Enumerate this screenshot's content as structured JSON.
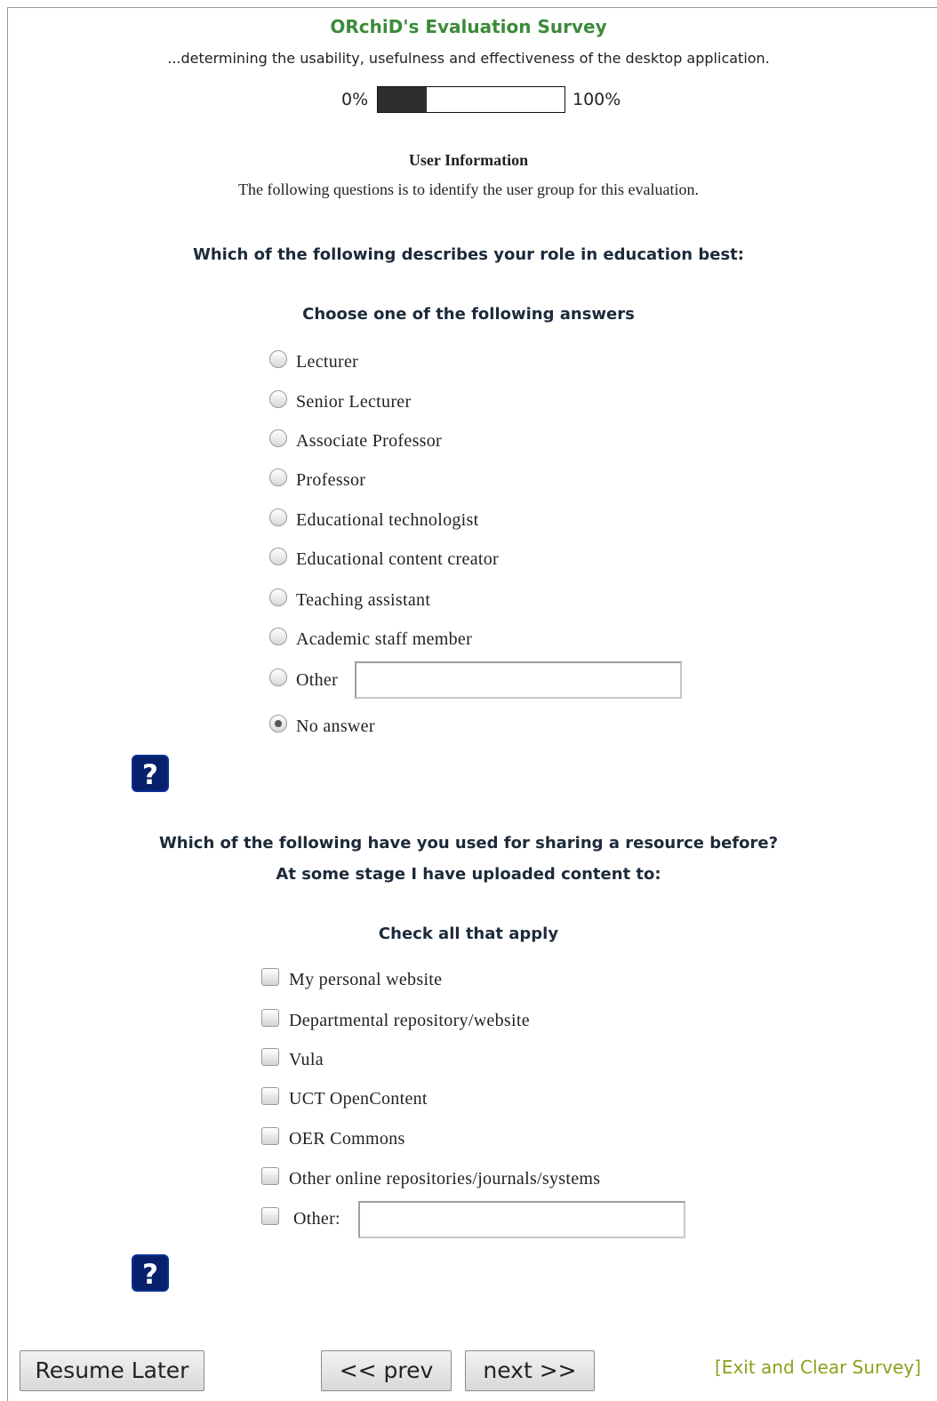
{
  "survey": {
    "title": "ORchiD's Evaluation Survey",
    "description": "...determining the usability, usefulness and effectiveness of the desktop application."
  },
  "progress": {
    "left_label": "0%",
    "right_label": "100%",
    "fraction": 0.26
  },
  "group": {
    "name": "User Information",
    "description": "The following questions is to identify the user group for this evaluation."
  },
  "q1": {
    "text": "Which of the following describes your role in education best:",
    "instruction": "Choose one of the following answers",
    "options": [
      {
        "label": "Lecturer",
        "checked": false
      },
      {
        "label": "Senior Lecturer",
        "checked": false
      },
      {
        "label": "Associate Professor",
        "checked": false
      },
      {
        "label": "Professor",
        "checked": false
      },
      {
        "label": "Educational technologist",
        "checked": false
      },
      {
        "label": "Educational content creator",
        "checked": false
      },
      {
        "label": "Teaching assistant",
        "checked": false
      },
      {
        "label": "Academic staff member",
        "checked": false
      },
      {
        "label": "Other",
        "checked": false,
        "other_value": ""
      },
      {
        "label": "No answer",
        "checked": true
      }
    ],
    "help_label": "?"
  },
  "q2": {
    "text_line1": "Which of the following have you used for sharing a resource before?",
    "text_line2": "At some stage I have uploaded content to:",
    "instruction": "Check all that apply",
    "options": [
      {
        "label": "My personal website",
        "checked": false
      },
      {
        "label": "Departmental repository/website",
        "checked": false
      },
      {
        "label": "Vula",
        "checked": false
      },
      {
        "label": "UCT OpenContent",
        "checked": false
      },
      {
        "label": "OER Commons",
        "checked": false
      },
      {
        "label": "Other online repositories/journals/systems",
        "checked": false
      },
      {
        "label": "Other:",
        "checked": false,
        "other_value": ""
      }
    ],
    "help_label": "?"
  },
  "nav": {
    "resume_later": "Resume Later",
    "prev": "<< prev",
    "next": "next >>",
    "exit": "[Exit and Clear Survey]"
  },
  "colors": {
    "title": "#3b8a3b",
    "help_button": "#06206b",
    "exit_link": "#8aa21a"
  }
}
